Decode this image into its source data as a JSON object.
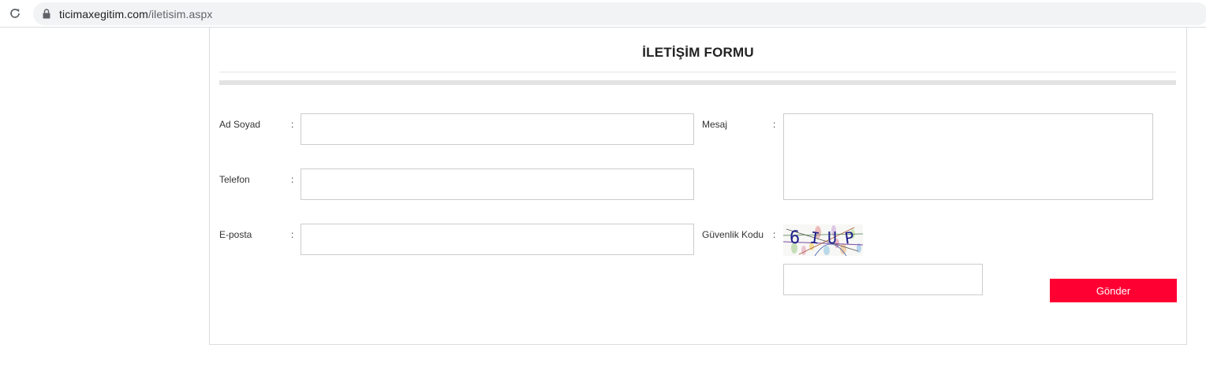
{
  "browser": {
    "url_domain": "ticimaxegitim.com",
    "url_path": "/iletisim.aspx"
  },
  "form": {
    "title": "İLETİŞİM FORMU",
    "fields": {
      "name": {
        "label": "Ad Soyad",
        "colon": ":",
        "value": ""
      },
      "phone": {
        "label": "Telefon",
        "colon": ":",
        "value": ""
      },
      "email": {
        "label": "E-posta",
        "colon": ":",
        "value": ""
      },
      "message": {
        "label": "Mesaj",
        "colon": ":",
        "value": ""
      },
      "security": {
        "label": "Güvenlik Kodu",
        "colon": ":",
        "value": ""
      }
    },
    "captcha_text": "6IUP",
    "submit_label": "Gönder"
  },
  "colors": {
    "accent": "#ff0033",
    "border": "#cccccc",
    "divider": "#e3e3e3"
  },
  "icons": [
    "reload-icon",
    "lock-icon"
  ]
}
